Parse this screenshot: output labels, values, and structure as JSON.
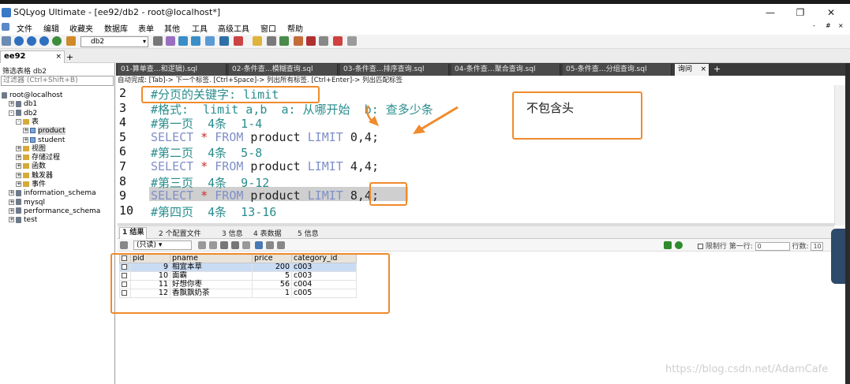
{
  "window": {
    "title": "SQLyog Ultimate - [ee92/db2 - root@localhost*]",
    "controls": [
      "—",
      "❐",
      "✕"
    ]
  },
  "menu": [
    "文件",
    "编辑",
    "收藏夹",
    "数据库",
    "表单",
    "其他",
    "工具",
    "高级工具",
    "窗口",
    "帮助"
  ],
  "mdi_controls": [
    "-",
    "#",
    "×"
  ],
  "toolbar": {
    "db_select": "db2"
  },
  "session_tab": {
    "label": "ee92",
    "close": "×",
    "add": "+"
  },
  "left_panel": {
    "filter_label": "筛选表格 db2",
    "filter_placeholder": "过滤器 (Ctrl+Shift+B)",
    "tree": [
      {
        "label": "root@localhost",
        "icon": "server-icon",
        "indent": 0,
        "expander": ""
      },
      {
        "label": "db1",
        "icon": "database-icon",
        "indent": 1,
        "expander": "+"
      },
      {
        "label": "db2",
        "icon": "database-icon",
        "indent": 1,
        "expander": "-"
      },
      {
        "label": "表",
        "icon": "folder-icon",
        "indent": 2,
        "expander": "-"
      },
      {
        "label": "product",
        "icon": "table-icon",
        "indent": 3,
        "expander": "+",
        "selected": true
      },
      {
        "label": "student",
        "icon": "table-icon",
        "indent": 3,
        "expander": "+"
      },
      {
        "label": "视图",
        "icon": "folder-icon",
        "indent": 2,
        "expander": "+"
      },
      {
        "label": "存储过程",
        "icon": "folder-icon",
        "indent": 2,
        "expander": "+"
      },
      {
        "label": "函数",
        "icon": "folder-icon",
        "indent": 2,
        "expander": "+"
      },
      {
        "label": "触发器",
        "icon": "folder-icon",
        "indent": 2,
        "expander": "+"
      },
      {
        "label": "事件",
        "icon": "folder-icon",
        "indent": 2,
        "expander": "+"
      },
      {
        "label": "information_schema",
        "icon": "database-icon",
        "indent": 1,
        "expander": "+"
      },
      {
        "label": "mysql",
        "icon": "database-icon",
        "indent": 1,
        "expander": "+"
      },
      {
        "label": "performance_schema",
        "icon": "database-icon",
        "indent": 1,
        "expander": "+"
      },
      {
        "label": "test",
        "icon": "database-icon",
        "indent": 1,
        "expander": "+"
      }
    ]
  },
  "editor_tabs": [
    {
      "label": "01-算单查…和逻辑).sql"
    },
    {
      "label": "02-条件查…模糊查询.sql"
    },
    {
      "label": "03-条件查…排序查询.sql"
    },
    {
      "label": "04-条件查…聚合查询.sql"
    },
    {
      "label": "05-条件查…分组查询.sql"
    },
    {
      "label": "询问",
      "active": true
    }
  ],
  "hint_line": "自动完成: [Tab]-> 下一个标签. [Ctrl+Space]-> 列出所有标签. [Ctrl+Enter]-> 列出匹配标签",
  "editor": {
    "lines": [
      {
        "num": "2",
        "tokens": [
          {
            "t": "#分页的关键字: limit",
            "c": "cmt"
          }
        ]
      },
      {
        "num": "3",
        "tokens": [
          {
            "t": "#格式:  limit a,b  a: 从哪开始  b: 查多少条",
            "c": "cmt"
          }
        ]
      },
      {
        "num": "4",
        "tokens": [
          {
            "t": "#第一页  4条  1-4",
            "c": "cmt"
          }
        ]
      },
      {
        "num": "5",
        "tokens": [
          {
            "t": "SELECT",
            "c": "kw"
          },
          {
            "t": " ",
            "c": "id"
          },
          {
            "t": "*",
            "c": "op"
          },
          {
            "t": " ",
            "c": "id"
          },
          {
            "t": "FROM",
            "c": "kw"
          },
          {
            "t": " product ",
            "c": "id"
          },
          {
            "t": "LIMIT",
            "c": "kw"
          },
          {
            "t": " 0,4;",
            "c": "num"
          }
        ]
      },
      {
        "num": "6",
        "tokens": [
          {
            "t": "#第二页  4条  5-8",
            "c": "cmt"
          }
        ]
      },
      {
        "num": "7",
        "tokens": [
          {
            "t": "SELECT",
            "c": "kw"
          },
          {
            "t": " ",
            "c": "id"
          },
          {
            "t": "*",
            "c": "op"
          },
          {
            "t": " ",
            "c": "id"
          },
          {
            "t": "FROM",
            "c": "kw"
          },
          {
            "t": " product ",
            "c": "id"
          },
          {
            "t": "LIMIT",
            "c": "kw"
          },
          {
            "t": " 4,4;",
            "c": "num"
          }
        ]
      },
      {
        "num": "8",
        "tokens": [
          {
            "t": "#第三页  4条  9-12",
            "c": "cmt"
          }
        ]
      },
      {
        "num": "9",
        "tokens": [
          {
            "t": "SELECT",
            "c": "kw"
          },
          {
            "t": " ",
            "c": "id"
          },
          {
            "t": "*",
            "c": "op"
          },
          {
            "t": " ",
            "c": "id"
          },
          {
            "t": "FROM",
            "c": "kw"
          },
          {
            "t": " product ",
            "c": "id"
          },
          {
            "t": "LIMIT",
            "c": "kw"
          },
          {
            "t": " 8,4;",
            "c": "num"
          }
        ],
        "highlighted": true
      },
      {
        "num": "10",
        "tokens": [
          {
            "t": "#第四页  4条  13-16",
            "c": "cmt"
          }
        ]
      }
    ]
  },
  "annotation": {
    "note": "不包含头"
  },
  "result_tabs": [
    "1 结果",
    "2 个配置文件",
    "3 信息",
    "4 表数据",
    "5 信息"
  ],
  "result_toolbar": {
    "mode": "(只读)",
    "limit_label": "限制行 第一行:",
    "limit_first": "0",
    "rows_label": "行数:",
    "rows_value": "10"
  },
  "result_grid": {
    "columns": [
      "pid",
      "pname",
      "price",
      "category_id"
    ],
    "rows": [
      {
        "pid": "9",
        "pname": "相宜本草",
        "price": "200",
        "category_id": "c003",
        "selected": true
      },
      {
        "pid": "10",
        "pname": "面霸",
        "price": "5",
        "category_id": "c003"
      },
      {
        "pid": "11",
        "pname": "好想你枣",
        "price": "56",
        "category_id": "c004"
      },
      {
        "pid": "12",
        "pname": "香飘飘奶茶",
        "price": "1",
        "category_id": "c005"
      }
    ]
  },
  "watermark": "https://blog.csdn.net/AdamCafe",
  "colors": {
    "annotation_orange": "#f08a2c",
    "arrow_orange": "#f08a2c",
    "comment_teal": "#2a8d8d",
    "keyword_blue": "#7f8fc8"
  }
}
